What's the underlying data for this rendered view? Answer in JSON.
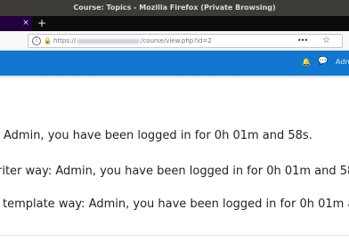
{
  "window": {
    "title": "Course: Topics - Mozilla Firefox (Private Browsing)"
  },
  "tabs": {
    "close_glyph": "×",
    "new_tab_glyph": "+"
  },
  "navbar": {
    "info_glyph": "i",
    "url_prefix": "https://",
    "url_suffix": "/course/view.php?id=2",
    "more_glyph": "•••",
    "star_glyph": "☆"
  },
  "appbar": {
    "user_label": "Adm",
    "color": "#1177d1"
  },
  "content": {
    "lines": [
      "Admin, you have been logged in for 0h 01m and 58s.",
      "riter way: Admin, you have been logged in for 0h 01m and 58s",
      "template way: Admin, you have been logged in for 0h 01m an"
    ]
  }
}
